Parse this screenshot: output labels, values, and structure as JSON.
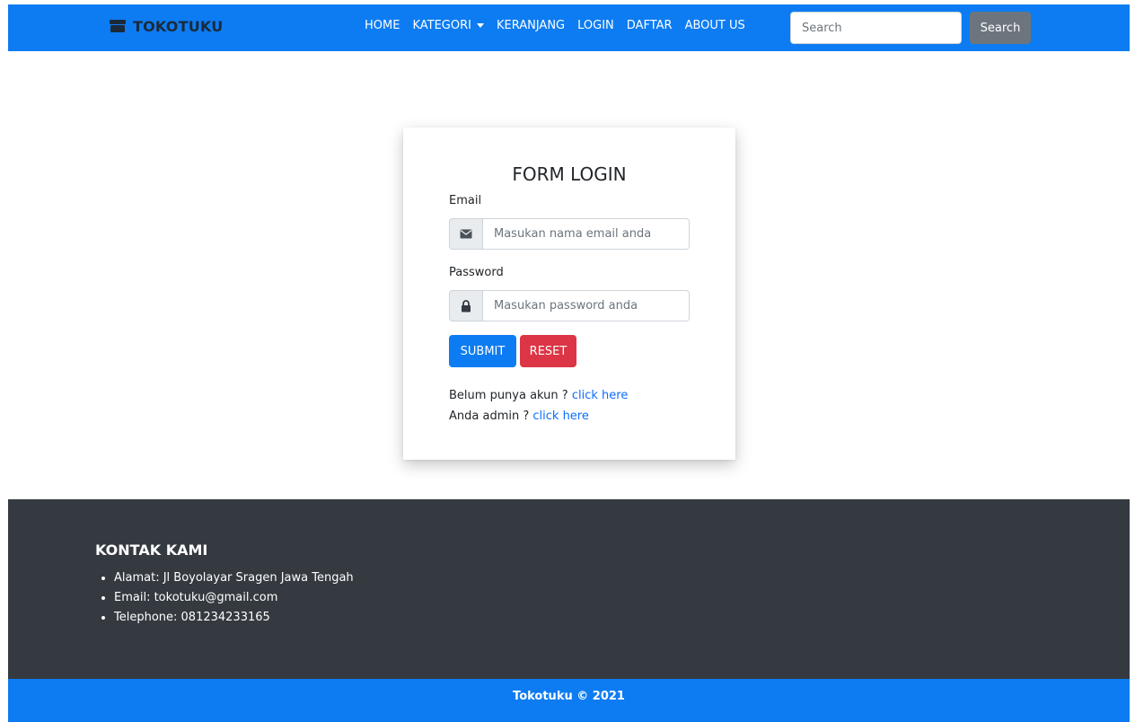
{
  "navbar": {
    "brand": "TOKOTUKU",
    "links": [
      "HOME",
      "KATEGORI",
      "KERANJANG",
      "LOGIN",
      "DAFTAR",
      "ABOUT US"
    ],
    "search_placeholder": "Search",
    "search_button": "Search",
    "color": "#0d7cf2"
  },
  "form": {
    "title": "FORM LOGIN",
    "email_label": "Email",
    "email_placeholder": "Masukan nama email anda",
    "password_label": "Password",
    "password_placeholder": "Masukan password anda",
    "submit_label": "SUBMIT",
    "reset_label": "RESET",
    "register_text": "Belum punya akun ?",
    "register_link": "click here",
    "admin_text": "Anda admin ?",
    "admin_link": "click here",
    "icons": [
      "envelope-icon",
      "lock-icon"
    ]
  },
  "footer": {
    "title": "KONTAK KAMI",
    "items": [
      "Alamat: Jl Boyolayar Sragen Jawa Tengah",
      "Email: tokotuku@gmail.com",
      "Telephone: 081234233165"
    ],
    "copyright": "Tokotuku © 2021",
    "background": "#343a40"
  }
}
